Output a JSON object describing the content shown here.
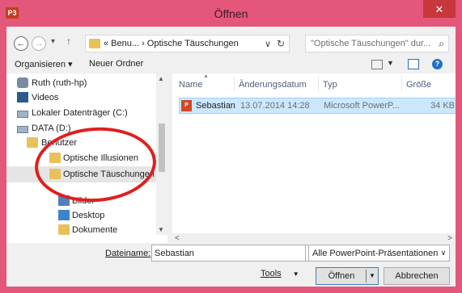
{
  "window": {
    "title": "Öffnen",
    "app_icon": "P3",
    "close_label": "✕",
    "colors": {
      "frame": "#e4577a",
      "close": "#c7373b",
      "selection": "#cce8ff"
    }
  },
  "address": {
    "back": "←",
    "forward": "→",
    "recent": "▾",
    "up": "↑",
    "path": "« Benu... › Optische Täuschungen",
    "dropdown": "∨",
    "refresh": "↻"
  },
  "search": {
    "placeholder": "\"Optische Täuschungen\" dur...",
    "icon": "⌕"
  },
  "toolbar": {
    "organize": "Organisieren ▾",
    "new_folder": "Neuer Ordner",
    "view_dropdown": "▼",
    "help": "?"
  },
  "nav": {
    "items": [
      {
        "label": "Ruth (ruth-hp)",
        "icon": "user-icon"
      },
      {
        "label": "Videos",
        "icon": "video-icon"
      },
      {
        "label": "Lokaler Datenträger (C:)",
        "icon": "drive-icon"
      },
      {
        "label": "DATA (D:)",
        "icon": "drive-icon"
      },
      {
        "label": "Benutzer",
        "icon": "folder-icon"
      },
      {
        "label": "Optische Illusionen",
        "icon": "folder-icon"
      },
      {
        "label": "Optische Täuschungen",
        "icon": "folder-icon",
        "selected": true
      },
      {
        "label": "Bilder",
        "icon": "pictures-icon"
      },
      {
        "label": "Desktop",
        "icon": "desktop-icon"
      },
      {
        "label": "Dokumente",
        "icon": "documents-icon"
      }
    ]
  },
  "files": {
    "columns": [
      "Name",
      "Änderungsdatum",
      "Typ",
      "Größe"
    ],
    "rows": [
      {
        "name": "Sebastian",
        "date": "13.07.2014 14:28",
        "type": "Microsoft PowerP...",
        "size": "34 KB",
        "icon": "P"
      }
    ]
  },
  "bottom": {
    "filename_label": "Dateiname:",
    "filename_value": "Sebastian",
    "filetype_value": "Alle PowerPoint-Präsentationen",
    "tools_label": "Tools",
    "open_label": "Öffnen",
    "cancel_label": "Abbrechen"
  },
  "annotation": {
    "color": "#e11d1d"
  }
}
